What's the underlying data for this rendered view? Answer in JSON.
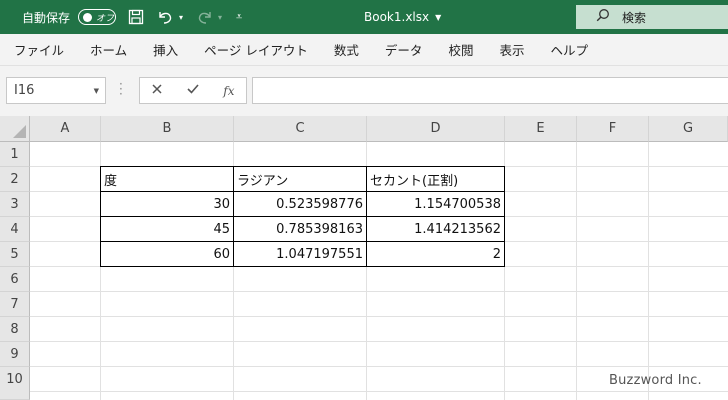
{
  "titlebar": {
    "autosave_label": "自動保存",
    "autosave_state": "オフ",
    "document_title": "Book1.xlsx",
    "search_label": "検索"
  },
  "ribbon": {
    "tabs": [
      "ファイル",
      "ホーム",
      "挿入",
      "ページ レイアウト",
      "数式",
      "データ",
      "校閲",
      "表示",
      "ヘルプ"
    ]
  },
  "formula_bar": {
    "name_box": "I16",
    "fx_label": "fx",
    "formula": ""
  },
  "sheet": {
    "columns": [
      "A",
      "B",
      "C",
      "D",
      "E",
      "F",
      "G"
    ],
    "rows": [
      "1",
      "2",
      "3",
      "4",
      "5",
      "6",
      "7",
      "8",
      "9",
      "10"
    ],
    "table": {
      "headers": [
        "度",
        "ラジアン",
        "セカント(正割)"
      ],
      "rows": [
        [
          "30",
          "0.523598776",
          "1.154700538"
        ],
        [
          "45",
          "0.785398163",
          "1.414213562"
        ],
        [
          "60",
          "1.047197551",
          "2"
        ]
      ]
    }
  },
  "watermark": "Buzzword Inc.",
  "colors": {
    "titlebar": "#217346",
    "search_box": "#c6dfd0"
  }
}
